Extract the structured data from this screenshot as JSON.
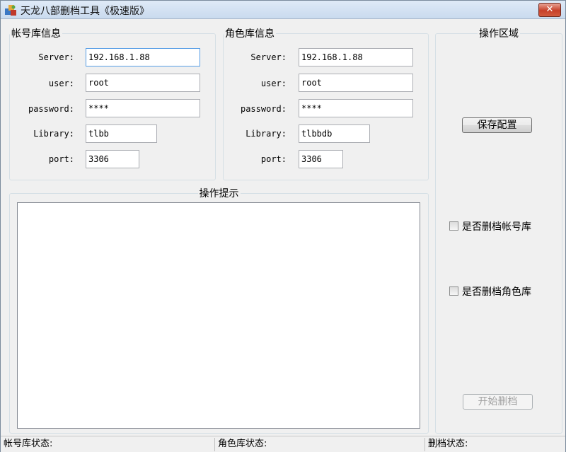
{
  "window": {
    "title": "天龙八部删档工具《极速版》",
    "close_label": "✕"
  },
  "account_group": {
    "legend": "帐号库信息",
    "fields": [
      {
        "label": "Server:",
        "value": "192.168.1.88"
      },
      {
        "label": "user:",
        "value": "root"
      },
      {
        "label": "password:",
        "value": "****"
      },
      {
        "label": "Library:",
        "value": "tlbb"
      },
      {
        "label": "port:",
        "value": "3306"
      }
    ]
  },
  "role_group": {
    "legend": "角色库信息",
    "fields": [
      {
        "label": "Server:",
        "value": "192.168.1.88"
      },
      {
        "label": "user:",
        "value": "root"
      },
      {
        "label": "password:",
        "value": "****"
      },
      {
        "label": "Library:",
        "value": "tlbbdb"
      },
      {
        "label": "port:",
        "value": "3306"
      }
    ]
  },
  "hint_group": {
    "legend": "操作提示",
    "content": ""
  },
  "action_group": {
    "legend": "操作区域",
    "save_button": "保存配置",
    "delete_account_checkbox": {
      "label": "是否删档帐号库",
      "checked": false
    },
    "delete_role_checkbox": {
      "label": "是否删档角色库",
      "checked": false
    },
    "start_button": "开始删档"
  },
  "statusbar": {
    "account_status": "帐号库状态:",
    "role_status": "角色库状态:",
    "delete_status": "删档状态:"
  }
}
